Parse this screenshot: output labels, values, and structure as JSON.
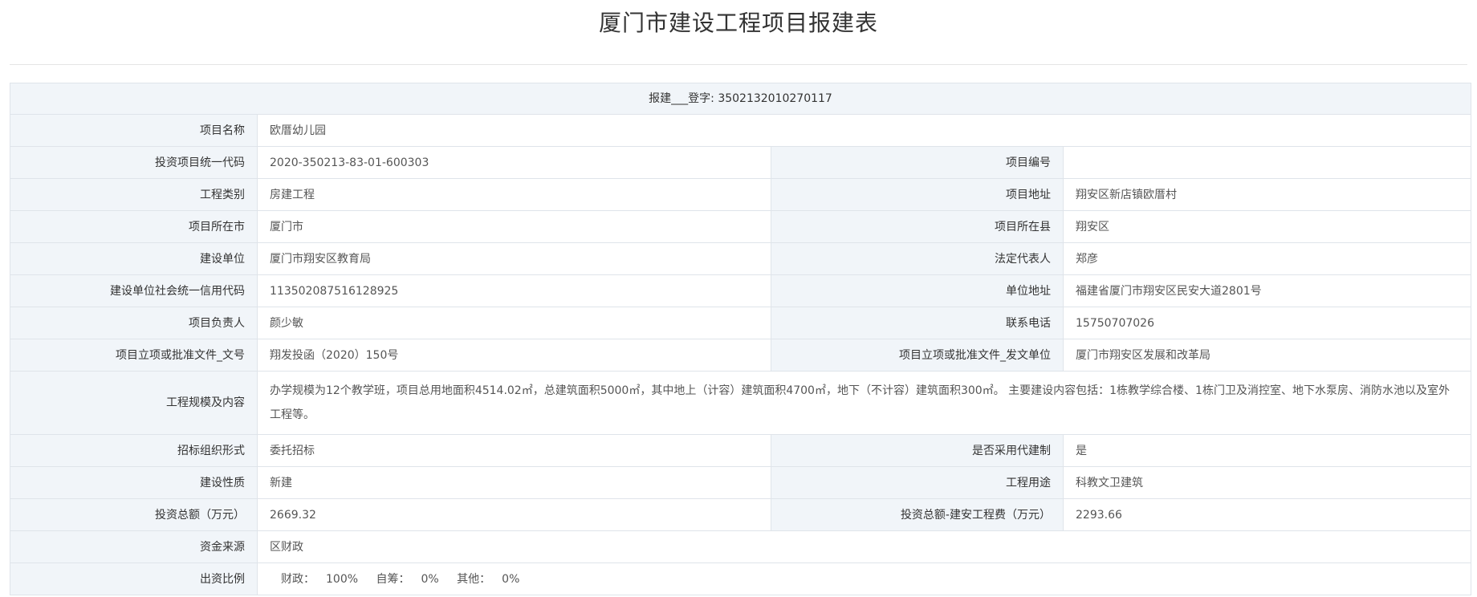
{
  "title": "厦门市建设工程项目报建表",
  "registration": {
    "label": "报建___登字:",
    "number": "3502132010270117"
  },
  "rows": {
    "project_name": {
      "label": "项目名称",
      "value": "欧厝幼儿园"
    },
    "invest_code": {
      "label": "投资项目统一代码",
      "value": "2020-350213-83-01-600303"
    },
    "project_no": {
      "label": "项目编号",
      "value": ""
    },
    "category": {
      "label": "工程类别",
      "value": "房建工程"
    },
    "address": {
      "label": "项目地址",
      "value": "翔安区新店镇欧厝村"
    },
    "city": {
      "label": "项目所在市",
      "value": "厦门市"
    },
    "county": {
      "label": "项目所在县",
      "value": "翔安区"
    },
    "builder": {
      "label": "建设单位",
      "value": "厦门市翔安区教育局"
    },
    "legal_rep": {
      "label": "法定代表人",
      "value": "郑彦"
    },
    "credit_code": {
      "label": "建设单位社会统一信用代码",
      "value": "113502087516128925"
    },
    "unit_address": {
      "label": "单位地址",
      "value": "福建省厦门市翔安区民安大道2801号"
    },
    "manager": {
      "label": "项目负责人",
      "value": "颜少敏"
    },
    "phone": {
      "label": "联系电话",
      "value": "15750707026"
    },
    "approval_doc": {
      "label": "项目立项或批准文件_文号",
      "value": "翔发投函（2020）150号"
    },
    "approval_unit": {
      "label": "项目立项或批准文件_发文单位",
      "value": "厦门市翔安区发展和改革局"
    },
    "scale": {
      "label": "工程规模及内容",
      "value": "办学规模为12个教学班，项目总用地面积4514.02㎡，总建筑面积5000㎡，其中地上（计容）建筑面积4700㎡，地下（不计容）建筑面积300㎡。 主要建设内容包括：1栋教学综合楼、1栋门卫及消控室、地下水泵房、消防水池以及室外工程等。"
    },
    "tender_form": {
      "label": "招标组织形式",
      "value": "委托招标"
    },
    "agent_build": {
      "label": "是否采用代建制",
      "value": "是"
    },
    "nature": {
      "label": "建设性质",
      "value": "新建"
    },
    "usage": {
      "label": "工程用途",
      "value": "科教文卫建筑"
    },
    "total_invest": {
      "label": "投资总额（万元）",
      "value": "2669.32"
    },
    "construct_fee": {
      "label": "投资总额-建安工程费（万元）",
      "value": "2293.66"
    },
    "fund_source": {
      "label": "资金来源",
      "value": "区财政"
    },
    "ratio": {
      "label": "出资比例",
      "items": [
        {
          "label": "财政：",
          "value": "100%"
        },
        {
          "label": "自筹：",
          "value": "0%"
        },
        {
          "label": "其他：",
          "value": "0%"
        }
      ]
    }
  }
}
